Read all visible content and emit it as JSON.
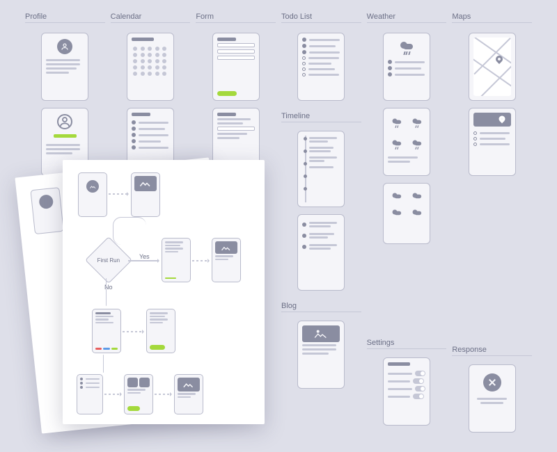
{
  "columns": {
    "profile": {
      "label": "Profile"
    },
    "calendar": {
      "label": "Calendar"
    },
    "form": {
      "label": "Form"
    },
    "todo": {
      "label": "Todo List"
    },
    "weather": {
      "label": "Weather"
    },
    "maps": {
      "label": "Maps"
    },
    "timeline": {
      "label": "Timeline"
    },
    "blog": {
      "label": "Blog"
    },
    "settings": {
      "label": "Settings"
    },
    "response": {
      "label": "Response"
    },
    "weather2": {
      "label": "Weathe"
    }
  },
  "flowchart": {
    "decision": "First Run",
    "yes": "Yes",
    "no": "No"
  }
}
